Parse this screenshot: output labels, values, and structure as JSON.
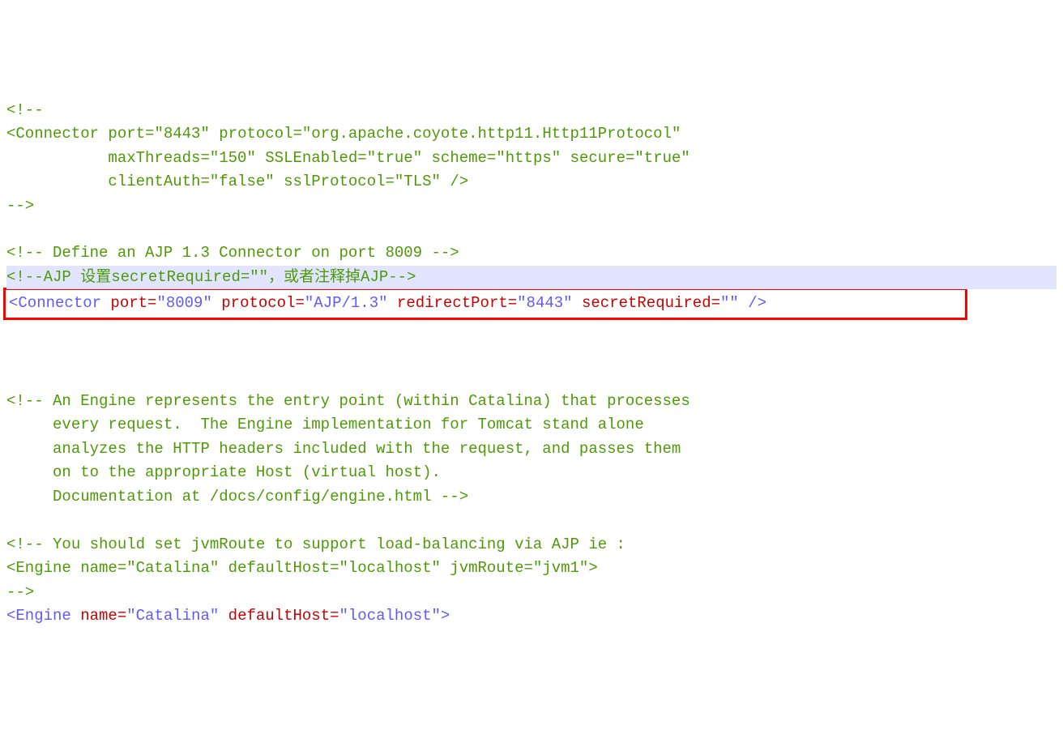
{
  "line1": "<!--",
  "line2": {
    "open": "<Connector ",
    "a1": "port=",
    "v1": "\"8443\"",
    "sp1": " ",
    "a2": "protocol=",
    "v2": "\"org.apache.coyote.http11.Http11Protocol\""
  },
  "line3": {
    "indent": "           ",
    "a1": "maxThreads=",
    "v1": "\"150\"",
    "sp1": " ",
    "a2": "SSLEnabled=",
    "v2": "\"true\"",
    "sp2": " ",
    "a3": "scheme=",
    "v3": "\"https\"",
    "sp3": " ",
    "a4": "secure=",
    "v4": "\"true\""
  },
  "line4": {
    "indent": "           ",
    "a1": "clientAuth=",
    "v1": "\"false\"",
    "sp1": " ",
    "a2": "sslProtocol=",
    "v2": "\"TLS\"",
    "close": " />"
  },
  "line5": "-->",
  "blank1": "",
  "line6": "<!-- Define an AJP 1.3 Connector on port 8009 -->",
  "line7": "<!--AJP 设置secretRequired=\"\"，或者注释掉AJP-->",
  "line8": {
    "open": "<Connector ",
    "a1": "port=",
    "v1": "\"8009\"",
    "sp1": " ",
    "a2": "protocol=",
    "v2": "\"AJP/1.3\"",
    "sp2": " ",
    "a3": "redirectPort=",
    "v3": "\"8443\"",
    "sp3": " ",
    "a4": "secretRequired=",
    "v4": "\"\"",
    "close": " />"
  },
  "blank2": "",
  "blank3": "",
  "line9a": "<!-- An Engine represents the entry point (within Catalina) that processes",
  "line9b": "     every request.  The Engine implementation for Tomcat stand alone",
  "line9c": "     analyzes the HTTP headers included with the request, and passes them",
  "line9d": "     on to the appropriate Host (virtual host).",
  "line9e": "     Documentation at /docs/config/engine.html -->",
  "blank4": "",
  "line10": "<!-- You should set jvmRoute to support load-balancing via AJP ie :",
  "line11": "<Engine name=\"Catalina\" defaultHost=\"localhost\" jvmRoute=\"jvm1\">",
  "line12": "-->",
  "line13": {
    "open": "<Engine ",
    "a1": "name=",
    "v1": "\"Catalina\"",
    "sp1": " ",
    "a2": "defaultHost=",
    "v2": "\"localhost\"",
    "close": ">"
  }
}
